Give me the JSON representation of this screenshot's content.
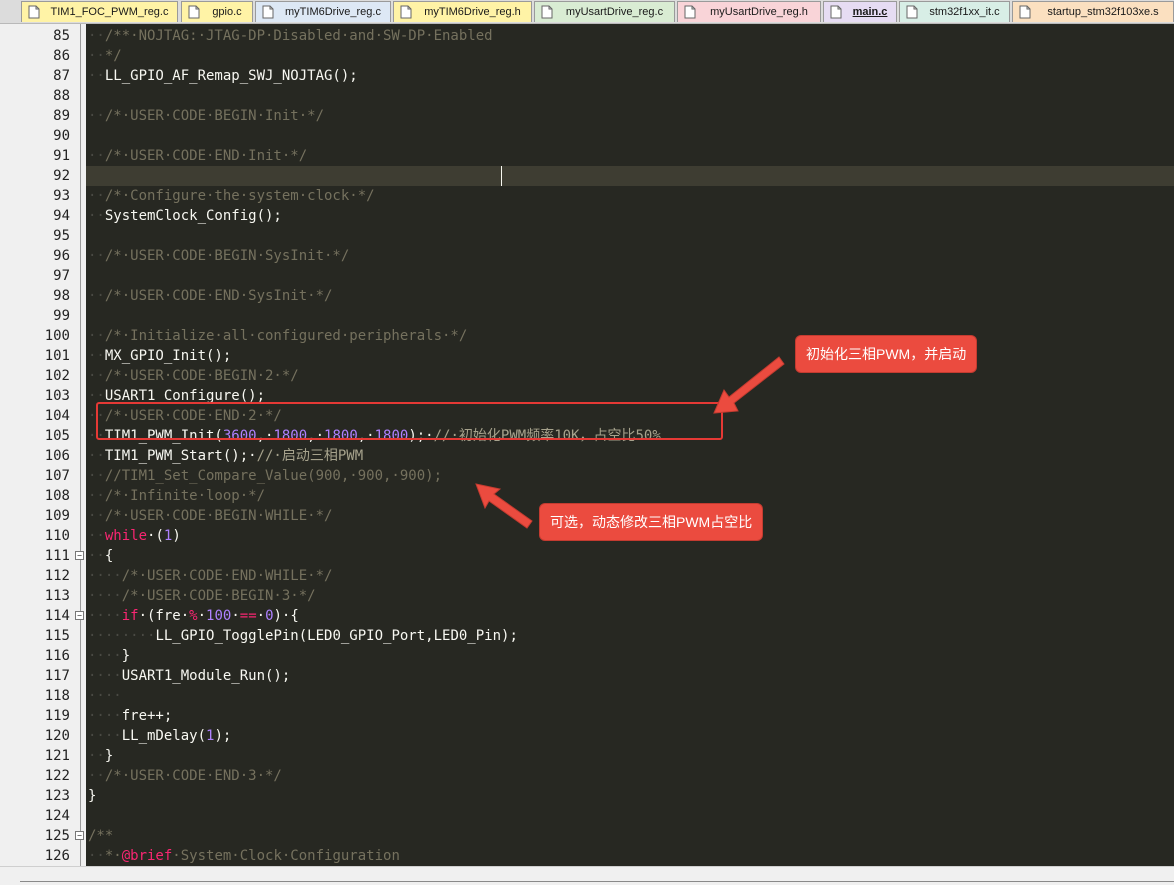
{
  "tabs": [
    {
      "label": "TIM1_FOC_PWM_reg.c",
      "color": "#fff3a6",
      "active": false
    },
    {
      "label": "gpio.c",
      "color": "#fff3a6",
      "active": false
    },
    {
      "label": "myTIM6Drive_reg.c",
      "color": "#dde8f5",
      "active": false
    },
    {
      "label": "myTIM6Drive_reg.h",
      "color": "#fff3a6",
      "active": false
    },
    {
      "label": "myUsartDrive_reg.c",
      "color": "#d9ecd3",
      "active": false
    },
    {
      "label": "myUsartDrive_reg.h",
      "color": "#f9d4d8",
      "active": false
    },
    {
      "label": "main.c",
      "color": "#e6dcf3",
      "active": true
    },
    {
      "label": "stm32f1xx_it.c",
      "color": "#d8eee6",
      "active": false
    },
    {
      "label": "startup_stm32f103xe.s",
      "color": "#fbe0c0",
      "active": false
    }
  ],
  "lines": [
    {
      "n": "85",
      "code": [
        [
          "ind",
          "··"
        ],
        [
          "cmt",
          "/**·NOJTAG:·JTAG-DP·Disabled·and·SW-DP·Enabled"
        ]
      ]
    },
    {
      "n": "86",
      "code": [
        [
          "ind",
          "··"
        ],
        [
          "cmt",
          "*/"
        ]
      ]
    },
    {
      "n": "87",
      "code": [
        [
          "ind",
          "··"
        ],
        [
          "fn",
          "LL_GPIO_AF_Remap_SWJ_NOJTAG();"
        ]
      ]
    },
    {
      "n": "88",
      "code": []
    },
    {
      "n": "89",
      "code": [
        [
          "ind",
          "··"
        ],
        [
          "cmt",
          "/*·USER·CODE·BEGIN·Init·*/"
        ]
      ]
    },
    {
      "n": "90",
      "code": []
    },
    {
      "n": "91",
      "code": [
        [
          "ind",
          "··"
        ],
        [
          "cmt",
          "/*·USER·CODE·END·Init·*/"
        ]
      ]
    },
    {
      "n": "92",
      "code": []
    },
    {
      "n": "93",
      "code": [
        [
          "ind",
          "··"
        ],
        [
          "cmt",
          "/*·Configure·the·system·clock·*/"
        ]
      ]
    },
    {
      "n": "94",
      "code": [
        [
          "ind",
          "··"
        ],
        [
          "fn",
          "SystemClock_Config();"
        ]
      ]
    },
    {
      "n": "95",
      "code": []
    },
    {
      "n": "96",
      "code": [
        [
          "ind",
          "··"
        ],
        [
          "cmt",
          "/*·USER·CODE·BEGIN·SysInit·*/"
        ]
      ]
    },
    {
      "n": "97",
      "code": []
    },
    {
      "n": "98",
      "code": [
        [
          "ind",
          "··"
        ],
        [
          "cmt",
          "/*·USER·CODE·END·SysInit·*/"
        ]
      ]
    },
    {
      "n": "99",
      "code": []
    },
    {
      "n": "100",
      "code": [
        [
          "ind",
          "··"
        ],
        [
          "cmt",
          "/*·Initialize·all·configured·peripherals·*/"
        ]
      ]
    },
    {
      "n": "101",
      "code": [
        [
          "ind",
          "··"
        ],
        [
          "fn",
          "MX_GPIO_Init();"
        ]
      ]
    },
    {
      "n": "102",
      "code": [
        [
          "ind",
          "··"
        ],
        [
          "cmt",
          "/*·USER·CODE·BEGIN·2·*/"
        ]
      ]
    },
    {
      "n": "103",
      "code": [
        [
          "ind",
          "··"
        ],
        [
          "fn",
          "USART1_Configure();"
        ]
      ]
    },
    {
      "n": "104",
      "code": [
        [
          "ind",
          "··"
        ],
        [
          "cmt",
          "/*·USER·CODE·END·2·*/"
        ]
      ]
    },
    {
      "n": "105",
      "code": [
        [
          "ind",
          "··"
        ],
        [
          "fn",
          "TIM1_PWM_Init("
        ],
        [
          "num",
          "3600"
        ],
        [
          "fn",
          ",·"
        ],
        [
          "num",
          "1800"
        ],
        [
          "fn",
          ",·"
        ],
        [
          "num",
          "1800"
        ],
        [
          "fn",
          ",·"
        ],
        [
          "num",
          "1800"
        ],
        [
          "fn",
          ");·"
        ],
        [
          "cn",
          "//·初始化PWM频率10K，占空比50%"
        ]
      ]
    },
    {
      "n": "106",
      "code": [
        [
          "ind",
          "··"
        ],
        [
          "fn",
          "TIM1_PWM_Start();·"
        ],
        [
          "cn",
          "//·启动三相PWM"
        ]
      ]
    },
    {
      "n": "107",
      "code": [
        [
          "ind",
          "··"
        ],
        [
          "cmt",
          "//TIM1_Set_Compare_Value(900,·900,·900);"
        ]
      ]
    },
    {
      "n": "108",
      "code": [
        [
          "ind",
          "··"
        ],
        [
          "cmt",
          "/*·Infinite·loop·*/"
        ]
      ]
    },
    {
      "n": "109",
      "code": [
        [
          "ind",
          "··"
        ],
        [
          "cmt",
          "/*·USER·CODE·BEGIN·WHILE·*/"
        ]
      ]
    },
    {
      "n": "110",
      "code": [
        [
          "ind",
          "··"
        ],
        [
          "kw",
          "while"
        ],
        [
          "fn",
          "·("
        ],
        [
          "num",
          "1"
        ],
        [
          "fn",
          ")"
        ]
      ]
    },
    {
      "n": "111",
      "code": [
        [
          "ind",
          "··"
        ],
        [
          "fn",
          "{"
        ]
      ]
    },
    {
      "n": "112",
      "code": [
        [
          "ind",
          "····"
        ],
        [
          "cmt",
          "/*·USER·CODE·END·WHILE·*/"
        ]
      ]
    },
    {
      "n": "113",
      "code": [
        [
          "ind",
          "····"
        ],
        [
          "cmt",
          "/*·USER·CODE·BEGIN·3·*/"
        ]
      ]
    },
    {
      "n": "114",
      "code": [
        [
          "ind",
          "····"
        ],
        [
          "kw",
          "if"
        ],
        [
          "fn",
          "·(fre·"
        ],
        [
          "kw",
          "%"
        ],
        [
          "fn",
          "·"
        ],
        [
          "num",
          "100"
        ],
        [
          "fn",
          "·"
        ],
        [
          "kw",
          "=="
        ],
        [
          "fn",
          "·"
        ],
        [
          "num",
          "0"
        ],
        [
          "fn",
          ")·{"
        ]
      ]
    },
    {
      "n": "115",
      "code": [
        [
          "ind",
          "········"
        ],
        [
          "fn",
          "LL_GPIO_TogglePin(LED0_GPIO_Port,LED0_Pin);"
        ]
      ]
    },
    {
      "n": "116",
      "code": [
        [
          "ind",
          "····"
        ],
        [
          "fn",
          "}"
        ]
      ]
    },
    {
      "n": "117",
      "code": [
        [
          "ind",
          "····"
        ],
        [
          "fn",
          "USART1_Module_Run();"
        ]
      ]
    },
    {
      "n": "118",
      "code": [
        [
          "ind",
          "····"
        ]
      ]
    },
    {
      "n": "119",
      "code": [
        [
          "ind",
          "····"
        ],
        [
          "fn",
          "fre++;"
        ]
      ]
    },
    {
      "n": "120",
      "code": [
        [
          "ind",
          "····"
        ],
        [
          "fn",
          "LL_mDelay("
        ],
        [
          "num",
          "1"
        ],
        [
          "fn",
          ");"
        ]
      ]
    },
    {
      "n": "121",
      "code": [
        [
          "ind",
          "··"
        ],
        [
          "fn",
          "}"
        ]
      ]
    },
    {
      "n": "122",
      "code": [
        [
          "ind",
          "··"
        ],
        [
          "cmt",
          "/*·USER·CODE·END·3·*/"
        ]
      ]
    },
    {
      "n": "123",
      "code": [
        [
          "fn",
          "}"
        ]
      ]
    },
    {
      "n": "124",
      "code": []
    },
    {
      "n": "125",
      "code": [
        [
          "cmt",
          "/**"
        ]
      ]
    },
    {
      "n": "126",
      "code": [
        [
          "ind",
          "··"
        ],
        [
          "cmt",
          "*·"
        ],
        [
          "doc",
          "@brief"
        ],
        [
          "cmt",
          "·System·Clock·Configuration"
        ]
      ]
    }
  ],
  "folds": {
    "111": "minus",
    "114": "minus",
    "125": "minus"
  },
  "annotations": {
    "callout1": "初始化三相PWM，并启动",
    "callout2": "可选，动态修改三相PWM占空比",
    "accent": "#eb4b3f"
  },
  "icons": {
    "tab": "file-icon",
    "fold": "fold-toggle-icon",
    "arrow": "arrow-icon"
  }
}
